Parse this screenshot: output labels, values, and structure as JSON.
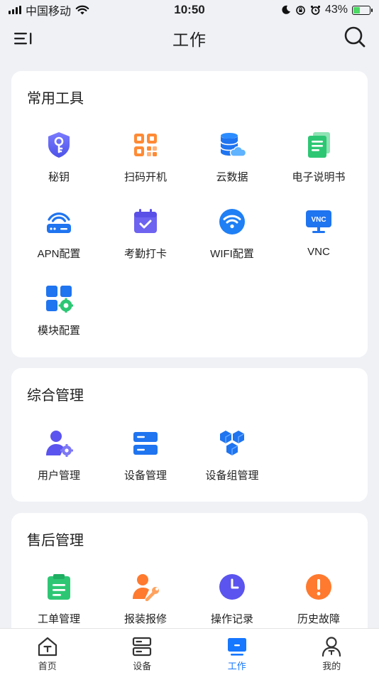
{
  "status_bar": {
    "carrier": "中国移动",
    "time": "10:50",
    "battery": "43%"
  },
  "header": {
    "title": "工作"
  },
  "sections": {
    "tools": {
      "title": "常用工具",
      "items": [
        {
          "label": "秘钥",
          "icon": "key-shield-icon"
        },
        {
          "label": "扫码开机",
          "icon": "qr-code-icon"
        },
        {
          "label": "云数据",
          "icon": "cloud-database-icon"
        },
        {
          "label": "电子说明书",
          "icon": "manual-document-icon"
        },
        {
          "label": "APN配置",
          "icon": "router-icon"
        },
        {
          "label": "考勤打卡",
          "icon": "calendar-check-icon"
        },
        {
          "label": "WIFI配置",
          "icon": "wifi-icon"
        },
        {
          "label": "VNC",
          "icon": "vnc-monitor-icon"
        },
        {
          "label": "模块配置",
          "icon": "module-gear-icon"
        }
      ]
    },
    "management": {
      "title": "综合管理",
      "items": [
        {
          "label": "用户管理",
          "icon": "user-gear-icon"
        },
        {
          "label": "设备管理",
          "icon": "server-icon"
        },
        {
          "label": "设备组管理",
          "icon": "cube-group-icon"
        }
      ]
    },
    "after_sales": {
      "title": "售后管理",
      "items": [
        {
          "label": "工单管理",
          "icon": "clipboard-icon"
        },
        {
          "label": "报装报修",
          "icon": "repair-user-icon"
        },
        {
          "label": "操作记录",
          "icon": "clock-icon"
        },
        {
          "label": "历史故障",
          "icon": "alert-icon"
        }
      ]
    }
  },
  "tabbar": {
    "items": [
      {
        "label": "首页",
        "icon": "home-icon"
      },
      {
        "label": "设备",
        "icon": "device-icon"
      },
      {
        "label": "工作",
        "icon": "work-icon",
        "active": true
      },
      {
        "label": "我的",
        "icon": "profile-icon"
      }
    ]
  },
  "colors": {
    "accent": "#1677ff",
    "background": "#eff1f5"
  }
}
